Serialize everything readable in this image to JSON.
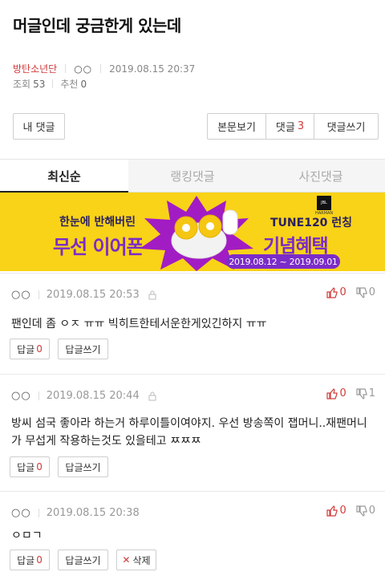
{
  "post": {
    "title": "머글인데 궁금한게 있는데",
    "author": "방탄소년단",
    "author_level": "○○",
    "datetime": "2019.08.15 20:37",
    "views_label": "조회",
    "views": "53",
    "recommend_label": "추천",
    "recommend": "0"
  },
  "buttons": {
    "my_comments": "내 댓글",
    "view_post": "본문보기",
    "comments_label": "댓글",
    "comments_count": "3",
    "write_comment": "댓글쓰기"
  },
  "tabs": [
    {
      "label": "최신순",
      "active": true
    },
    {
      "label": "랭킹댓글",
      "active": false
    },
    {
      "label": "사진댓글",
      "active": false
    }
  ],
  "banner": {
    "line1": "한눈에 반해버린",
    "line2": "무선 이어폰",
    "model": "TUNE120 런칭",
    "benefit": "기념혜택",
    "period": "2019.08.12 ~ 2019.09.01",
    "brand": "JBL",
    "brand_sub": "HARMAN"
  },
  "comments": [
    {
      "nick": "○○",
      "datetime": "2019.08.15 20:53",
      "up": "0",
      "down": "0",
      "text": "팬인데 좀 ㅇㅈ ㅠㅠ 빅히트한테서운한게있긴하지 ㅠㅠ",
      "reply_label": "답글",
      "reply_count": "0",
      "write_reply": "답글쓰기"
    },
    {
      "nick": "○○",
      "datetime": "2019.08.15 20:44",
      "up": "0",
      "down": "1",
      "text": "방씨 섬국 좋아라 하는거 하루이틀이여야지. 우선 방송쪽이 잽머니..재팬머니가 무섭게 작용하는것도 있을테고 ㅉㅉㅉ",
      "reply_label": "답글",
      "reply_count": "0",
      "write_reply": "답글쓰기"
    },
    {
      "nick": "○○",
      "datetime": "2019.08.15 20:38",
      "up": "0",
      "down": "0",
      "text": "ㅇㅁㄱ",
      "reply_label": "답글",
      "reply_count": "0",
      "write_reply": "답글쓰기",
      "delete_label": "삭제"
    }
  ],
  "colors": {
    "accent_red": "#d03a3a",
    "banner_yellow": "#f8d317",
    "banner_purple": "#7b2cc8"
  }
}
